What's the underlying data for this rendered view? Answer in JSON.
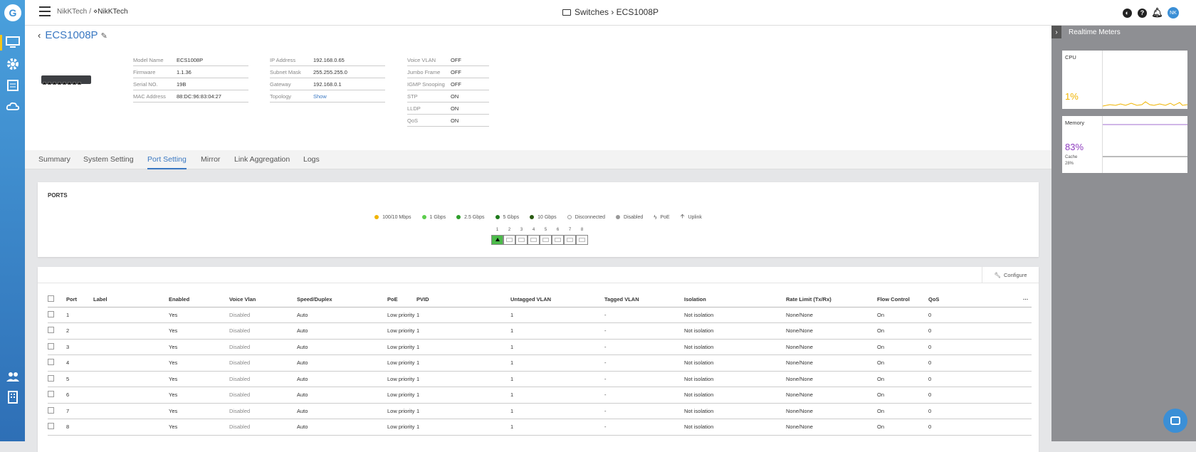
{
  "breadcrumb": {
    "root": "NikKTech",
    "sep": "/",
    "org": "NikKTech"
  },
  "page_title": "Switches › ECS1008P",
  "user_initials": "NK",
  "device": {
    "name": "ECS1008P",
    "col1": [
      {
        "k": "Model Name",
        "v": "ECS1008P"
      },
      {
        "k": "Firmware",
        "v": "1.1.36"
      },
      {
        "k": "Serial NO.",
        "v": "19B"
      },
      {
        "k": "MAC Address",
        "v": "88:DC:96:83:04:27"
      }
    ],
    "col2": [
      {
        "k": "IP Address",
        "v": "192.168.0.65"
      },
      {
        "k": "Subnet Mask",
        "v": "255.255.255.0"
      },
      {
        "k": "Gateway",
        "v": "192.168.0.1"
      },
      {
        "k": "Topology",
        "v": "Show"
      }
    ],
    "col3": [
      {
        "k": "Voice VLAN",
        "v": "OFF"
      },
      {
        "k": "Jumbo Frame",
        "v": "OFF"
      },
      {
        "k": "IGMP Snooping",
        "v": "OFF"
      },
      {
        "k": "STP",
        "v": "ON"
      },
      {
        "k": "LLDP",
        "v": "ON"
      },
      {
        "k": "QoS",
        "v": "ON"
      }
    ]
  },
  "tabs": [
    "Summary",
    "System Setting",
    "Port Setting",
    "Mirror",
    "Link Aggregation",
    "Logs"
  ],
  "active_tab": "Port Setting",
  "ports": {
    "title": "PORTS",
    "legend": [
      {
        "label": "100/10 Mbps",
        "color": "#f0b400"
      },
      {
        "label": "1 Gbps",
        "color": "#5ccd4c"
      },
      {
        "label": "2.5 Gbps",
        "color": "#2e9e2b"
      },
      {
        "label": "5 Gbps",
        "color": "#1e7a1c"
      },
      {
        "label": "10 Gbps",
        "color": "#2a5a12"
      },
      {
        "label": "Disconnected",
        "color": "#ffffff"
      },
      {
        "label": "Disabled",
        "color": "#999999"
      },
      {
        "label": "PoE",
        "color": "none"
      },
      {
        "label": "Uplink",
        "color": "none"
      }
    ],
    "numbers": [
      "1",
      "2",
      "3",
      "4",
      "5",
      "6",
      "7",
      "8"
    ]
  },
  "configure_label": "Configure",
  "table": {
    "headers": [
      "Port",
      "Label",
      "Enabled",
      "Voice Vlan",
      "Speed/Duplex",
      "PoE",
      "PVID",
      "Untagged VLAN",
      "Tagged VLAN",
      "Isolation",
      "Rate Limit (Tx/Rx)",
      "Flow Control",
      "QoS"
    ],
    "rows": [
      [
        "1",
        "",
        "Yes",
        "Disabled",
        "Auto",
        "Low priority",
        "1",
        "1",
        "-",
        "Not isolation",
        "None/None",
        "On",
        "0"
      ],
      [
        "2",
        "",
        "Yes",
        "Disabled",
        "Auto",
        "Low priority",
        "1",
        "1",
        "-",
        "Not isolation",
        "None/None",
        "On",
        "0"
      ],
      [
        "3",
        "",
        "Yes",
        "Disabled",
        "Auto",
        "Low priority",
        "1",
        "1",
        "-",
        "Not isolation",
        "None/None",
        "On",
        "0"
      ],
      [
        "4",
        "",
        "Yes",
        "Disabled",
        "Auto",
        "Low priority",
        "1",
        "1",
        "-",
        "Not isolation",
        "None/None",
        "On",
        "0"
      ],
      [
        "5",
        "",
        "Yes",
        "Disabled",
        "Auto",
        "Low priority",
        "1",
        "1",
        "-",
        "Not isolation",
        "None/None",
        "On",
        "0"
      ],
      [
        "6",
        "",
        "Yes",
        "Disabled",
        "Auto",
        "Low priority",
        "1",
        "1",
        "-",
        "Not isolation",
        "None/None",
        "On",
        "0"
      ],
      [
        "7",
        "",
        "Yes",
        "Disabled",
        "Auto",
        "Low priority",
        "1",
        "1",
        "-",
        "Not isolation",
        "None/None",
        "On",
        "0"
      ],
      [
        "8",
        "",
        "Yes",
        "Disabled",
        "Auto",
        "Low priority",
        "1",
        "1",
        "-",
        "Not isolation",
        "None/None",
        "On",
        "0"
      ]
    ]
  },
  "realtime": {
    "title": "Realtime Meters",
    "cpu": {
      "label": "CPU",
      "value": "1%"
    },
    "memory": {
      "label": "Memory",
      "value": "83%",
      "cache_label": "Cache",
      "cache_value": "28%"
    }
  }
}
